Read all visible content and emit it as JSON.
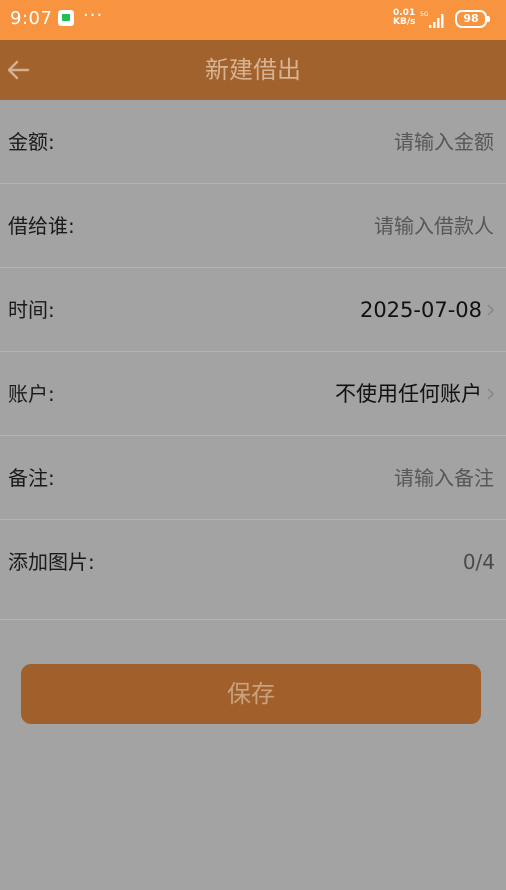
{
  "status_bar": {
    "time": "9:07",
    "more": "···",
    "net_speed_value": "0.01",
    "net_speed_unit": "KB/s",
    "battery": "98"
  },
  "header": {
    "title": "新建借出",
    "back_icon": "arrow-left-icon"
  },
  "form": {
    "amount": {
      "label": "金额:",
      "placeholder": "请输入金额"
    },
    "borrower": {
      "label": "借给谁:",
      "placeholder": "请输入借款人"
    },
    "time": {
      "label": "时间:",
      "value": "2025-07-08"
    },
    "account": {
      "label": "账户:",
      "value": "不使用任何账户"
    },
    "note": {
      "label": "备注:",
      "placeholder": "请输入备注"
    },
    "images": {
      "label": "添加图片:",
      "count": "0/4"
    }
  },
  "actions": {
    "save_label": "保存"
  },
  "colors": {
    "status_bar": "#f8943f",
    "nav_bar": "#a1622d",
    "overlay_background": "#a3a3a3",
    "save_button": "#a1602b"
  }
}
